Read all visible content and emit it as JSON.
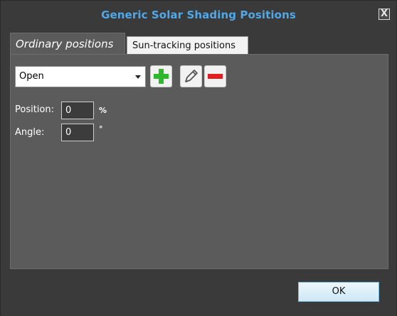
{
  "window": {
    "title": "Generic Solar Shading Positions",
    "close_label": "X"
  },
  "tabs": [
    {
      "label": "Ordinary positions",
      "active": true
    },
    {
      "label": "Sun-tracking positions",
      "active": false
    }
  ],
  "positions_dropdown": {
    "selected": "Open"
  },
  "toolbar": {
    "add_icon": "plus-icon",
    "edit_icon": "pencil-icon",
    "remove_icon": "minus-icon"
  },
  "fields": {
    "position": {
      "label": "Position:",
      "value": "0",
      "unit": "%"
    },
    "angle": {
      "label": "Angle:",
      "value": "0",
      "unit": "°"
    }
  },
  "footer": {
    "ok_label": "OK"
  },
  "colors": {
    "title_blue": "#4fa8e8",
    "background": "#3a3a3a",
    "panel": "#5b5b5b",
    "add_green": "#2eb82e",
    "remove_red": "#e02020"
  }
}
